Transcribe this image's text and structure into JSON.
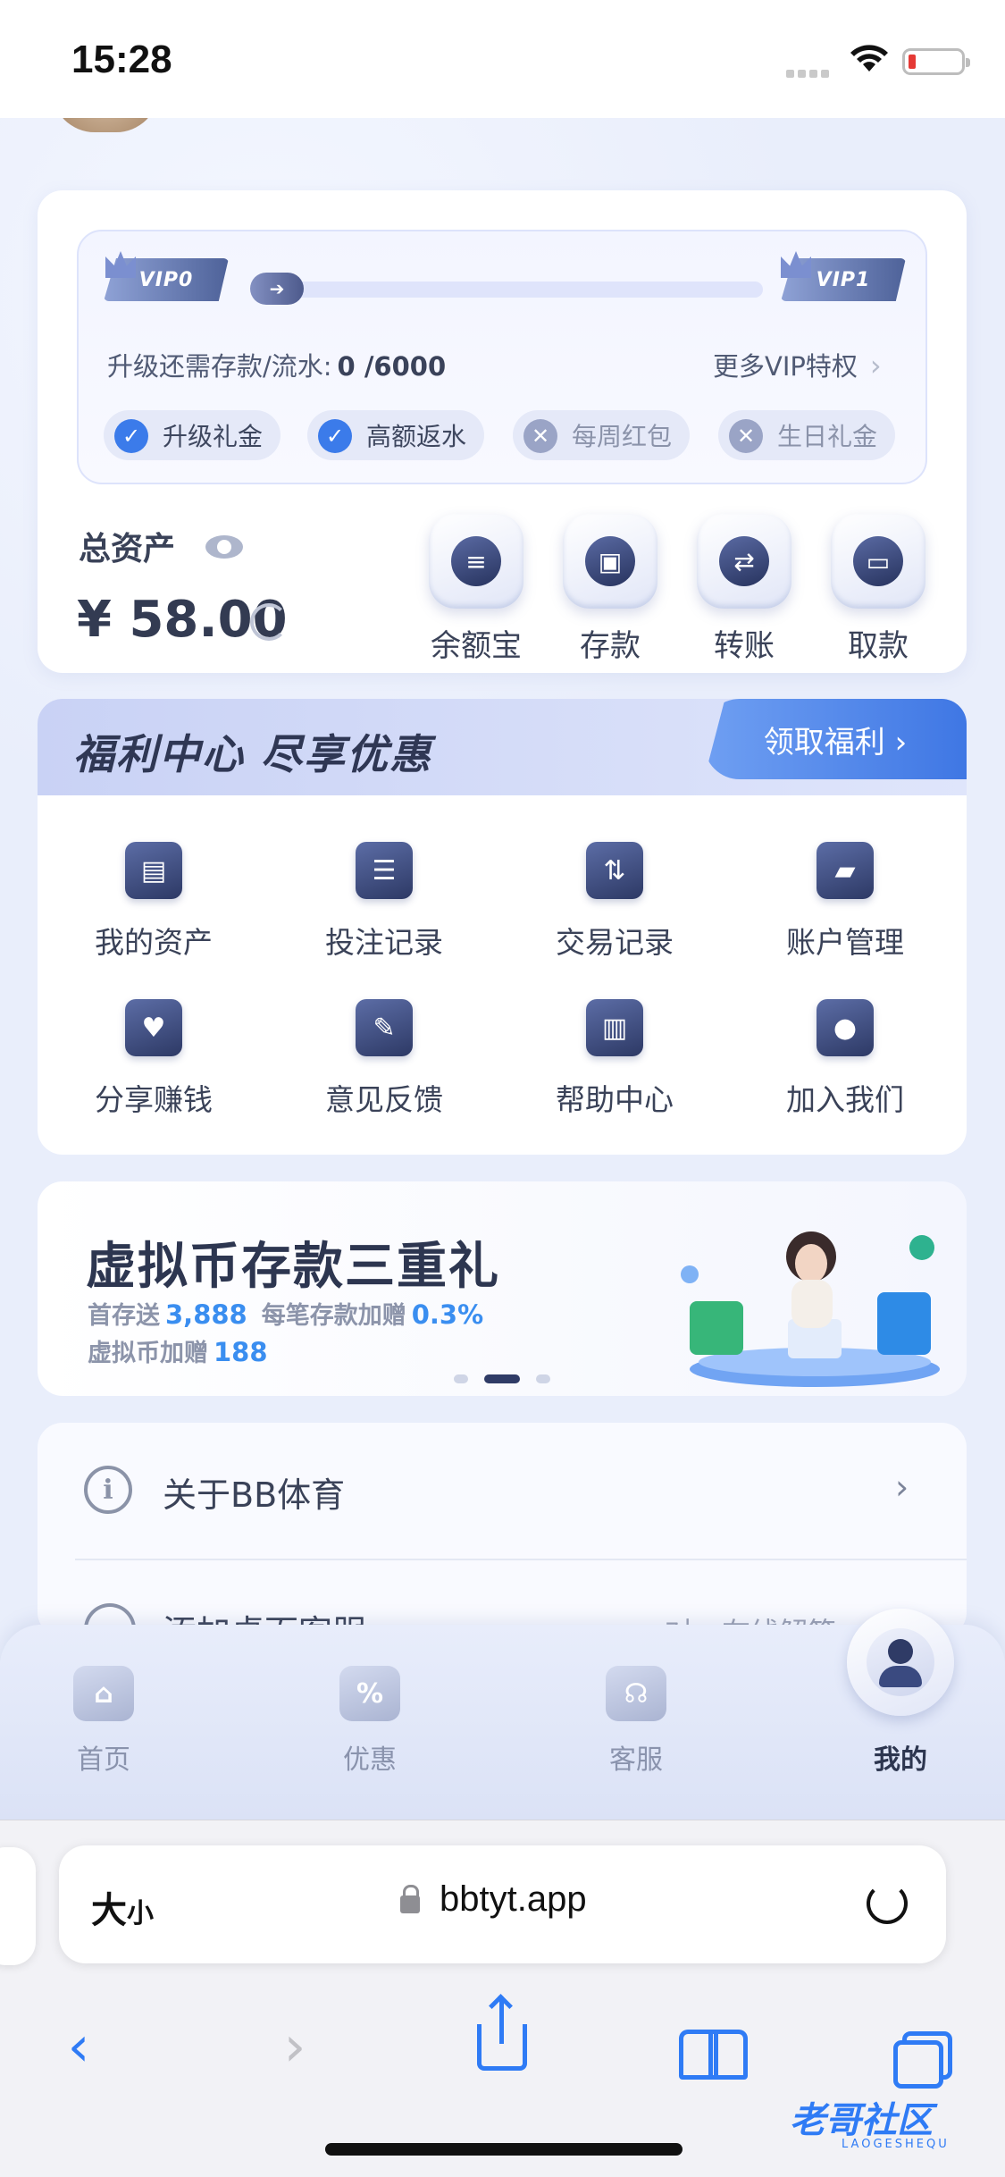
{
  "status_bar": {
    "time": "15:28"
  },
  "vip": {
    "current_level": "VIP0",
    "next_level": "VIP1",
    "progress": 0.0,
    "requirement_label": "升级还需存款/流水:",
    "requirement_value": "0 /6000",
    "more_link": "更多VIP特权",
    "perks": [
      {
        "label": "升级礼金",
        "enabled": true
      },
      {
        "label": "高额返水",
        "enabled": true
      },
      {
        "label": "每周红包",
        "enabled": false
      },
      {
        "label": "生日礼金",
        "enabled": false
      }
    ]
  },
  "assets": {
    "label": "总资产",
    "amount": "¥ 58.00",
    "actions": [
      {
        "label": "余额宝",
        "icon": "coin-stack-icon"
      },
      {
        "label": "存款",
        "icon": "wallet-icon"
      },
      {
        "label": "转账",
        "icon": "transfer-icon"
      },
      {
        "label": "取款",
        "icon": "card-icon"
      }
    ]
  },
  "benefits": {
    "title": "福利中心 尽享优惠",
    "claim_button": "领取福利 ›",
    "menu": [
      {
        "label": "我的资产",
        "icon": "wallet-icon"
      },
      {
        "label": "投注记录",
        "icon": "document-icon"
      },
      {
        "label": "交易记录",
        "icon": "exchange-icon"
      },
      {
        "label": "账户管理",
        "icon": "folder-icon"
      },
      {
        "label": "分享赚钱",
        "icon": "handshake-icon"
      },
      {
        "label": "意见反馈",
        "icon": "edit-icon"
      },
      {
        "label": "帮助中心",
        "icon": "book-icon"
      },
      {
        "label": "加入我们",
        "icon": "users-icon"
      }
    ]
  },
  "promo": {
    "title": "虚拟币存款三重礼",
    "line1_prefix": "首存送",
    "line1_value": "3,888",
    "line1_mid": "每笔存款加赠",
    "line1_pct": "0.3%",
    "line2_prefix": "虚拟币加赠",
    "line2_value": "188",
    "slide_count": 3,
    "active_slide": 1
  },
  "list": {
    "about": "关于BB体育",
    "add_desktop": "添加桌面客服",
    "add_desktop_hint": "一对一在线解答"
  },
  "tabbar": {
    "tabs": [
      {
        "label": "首页",
        "icon": "home-icon"
      },
      {
        "label": "优惠",
        "icon": "coupon-icon"
      },
      {
        "label": "客服",
        "icon": "headset-icon"
      },
      {
        "label": "我的",
        "icon": "user-icon",
        "active": true
      }
    ]
  },
  "browser": {
    "text_size_label": "大",
    "text_size_small": "小",
    "url": "bbtyt.app"
  },
  "watermark": {
    "text": "老哥社区",
    "sub": "LAOGESHEQU"
  },
  "colors": {
    "accent": "#3b7bea",
    "brand_dark": "#2f3b66",
    "safari_blue": "#2f7bf5"
  }
}
